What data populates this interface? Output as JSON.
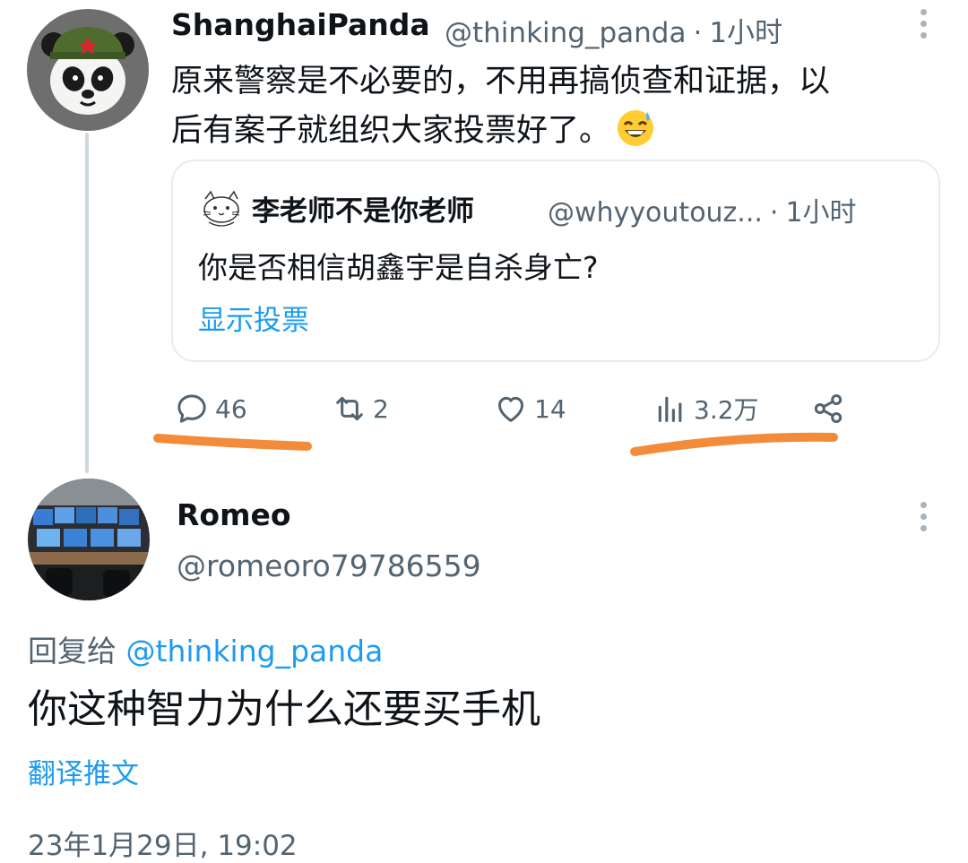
{
  "tweet": {
    "author_name": "ShanghaiPanda",
    "handle": "@thinking_panda",
    "time": "1小时",
    "text_line1": "原来警察是不必要的，不用再搞侦查和证据，以",
    "text_line2": "后有案子就组织大家投票好了。",
    "emoji": "grinning-sweat-emoji"
  },
  "quote": {
    "author_name": "李老师不是你老师",
    "handle": "@whyyoutouz...",
    "time": "1小时",
    "text": "你是否相信胡鑫宇是自杀身亡?",
    "poll_link": "显示投票"
  },
  "actions": {
    "replies": "46",
    "retweets": "2",
    "likes": "14",
    "views": "3.2万"
  },
  "reply": {
    "author_name": "Romeo",
    "handle": "@romeoro79786559",
    "reply_prefix": "回复给",
    "reply_mention": "@thinking_panda",
    "text": "你这种智力为什么还要买手机",
    "translate": "翻译推文",
    "timestamp": "23年1月29日, 19:02"
  },
  "icons": [
    "more-icon",
    "reply-icon",
    "retweet-icon",
    "like-icon",
    "views-icon",
    "share-icon"
  ],
  "colors": {
    "link": "#1d9bf0",
    "secondary_text": "#536471",
    "highlight_stroke": "#f28c3a",
    "thread_line": "#cfd9de"
  }
}
